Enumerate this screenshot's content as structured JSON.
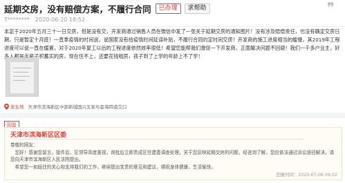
{
  "post": {
    "title": "延期交房，没有赔偿方案，不履行合同",
    "status_badge": "已办理",
    "category_badge": "求帮助",
    "author": "T********",
    "date": "2020-06-20 18:52",
    "body": "本定于2020年五月三十一日交房，但是没有交，开发商通过销售人员在微信中发了一张关于延期交房的通知图片！没有涉及赔偿责任，也没有确定交房日期，只是暂定十月底！一直拿疫情的时间说，说国家没有给疫情时间延误补贴，不履行合同约定时间交房！开发商的施工进度相当的缓慢，其2019年工程进度可以说一直在缓置，对于2020年复工以后的工程进度依然效率很低！希望您能帮我们督促一下开发商，正面解决问题不回避！我们一千多户业主，好多人都是半辈子积蓄买的房，现在住不上，还要花钱租房，孩子到了上学的年龄上不了学！",
    "location_from": "发生地",
    "location": "天津市滨海新区中部新城国兴五家与金海四道交口"
  },
  "reply": {
    "tag": "回复",
    "org": "天津市滨海新区区委",
    "greeting": "尊敬的网友：",
    "paragraph1": "您好！感谢您留言。接件后，区领导高度重视，询批后立即责成区住建委调查处理。关于您反映延期交房的问题，经咨询了解，您应依法通过诉讼途径解决，请您向天津市滨海新区人民法院提出。",
    "paragraph2": "希望您一如既往的关心和支持我们的工作，继续提出宝贵的意见和建议，顺祝身体健康，生活愉快。",
    "time": "回复时间：2020-07-06 09:02"
  }
}
